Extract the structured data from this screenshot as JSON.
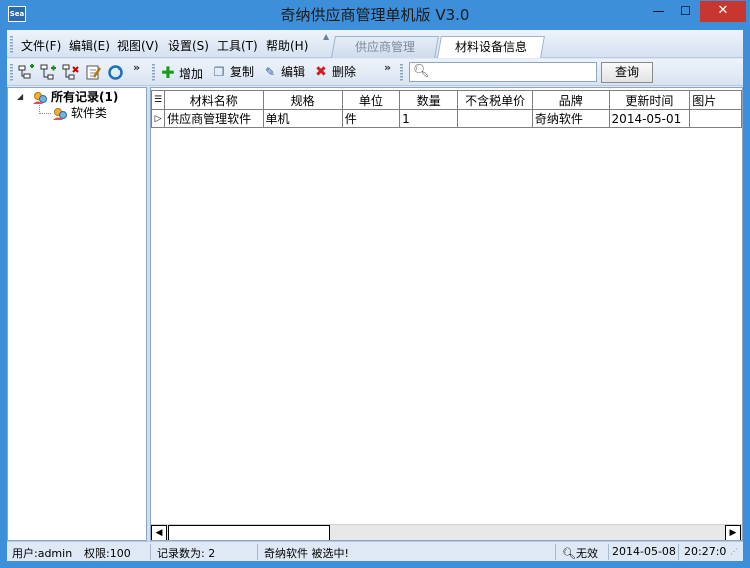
{
  "window": {
    "title": "奇纳供应商管理单机版 V3.0",
    "icon_label": "Sea",
    "minimize_glyph": "—",
    "maximize_glyph": "☐",
    "close_glyph": "✕"
  },
  "menubar": {
    "items": [
      "文件(F)",
      "编辑(E)",
      "视图(V)",
      "设置(S)",
      "工具(T)",
      "帮助(H)"
    ],
    "tabs": [
      {
        "label": "供应商管理",
        "active": false
      },
      {
        "label": "材料设备信息",
        "active": true
      }
    ]
  },
  "toolbar": {
    "tree_icons": [
      "add-node-icon",
      "add-child-icon",
      "delete-node-icon",
      "edit-node-icon",
      "refresh-icon"
    ],
    "overflow": "»",
    "overflow2": "»",
    "add_label": "增加",
    "copy_label": "复制",
    "edit_label": "编辑",
    "delete_label": "删除",
    "search_placeholder": "",
    "search_button": "查询"
  },
  "tree": {
    "root": "所有记录(1)",
    "children": [
      "软件类"
    ]
  },
  "grid": {
    "columns": [
      "材料名称",
      "规格",
      "单位",
      "数量",
      "不含税单价",
      "品牌",
      "更新时间",
      "图片"
    ],
    "rows": [
      [
        "供应商管理软件",
        "单机",
        "件",
        "1",
        "",
        "奇纳软件",
        "2014-05-01",
        ""
      ]
    ]
  },
  "status": {
    "user": "用户:admin",
    "permission": "权限:100",
    "record_count": "记录数为: 2",
    "message": "奇纳软件 被选中!",
    "state": "无效",
    "date": "2014-05-08",
    "time": "20:27:0"
  },
  "colors": {
    "title_bar": "#3c8fd8",
    "close_button": "#c7372f",
    "chrome": "#dfe9f5"
  }
}
